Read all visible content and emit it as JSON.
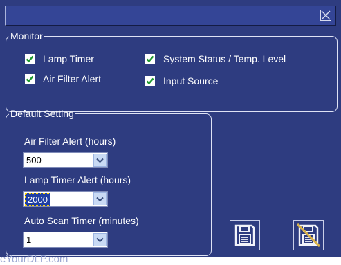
{
  "monitor": {
    "title": "Monitor",
    "options": [
      {
        "label": "Lamp Timer",
        "checked": true
      },
      {
        "label": "System Status / Temp. Level",
        "checked": true
      },
      {
        "label": "Air Filter Alert",
        "checked": true
      },
      {
        "label": "Input Source",
        "checked": true
      }
    ]
  },
  "default_setting": {
    "title": "Default Setting",
    "air_filter_alert": {
      "label": "Air Filter Alert (hours)",
      "value": "500"
    },
    "lamp_timer_alert": {
      "label": "Lamp Timer Alert (hours)",
      "value": "2000"
    },
    "auto_scan_timer": {
      "label": "Auto Scan Timer (minutes)",
      "value": "1"
    }
  },
  "icons": {
    "close": "close-icon",
    "save": "floppy-disk-icon",
    "no_save": "floppy-disk-crossed-icon",
    "check": "checkmark-icon",
    "dropdown": "chevron-down-icon"
  },
  "colors": {
    "background": "#2e3c80",
    "check": "#1e9a2e",
    "cancel_slash": "#d7b14a",
    "highlight": "#1f3fa4"
  },
  "watermark": "eYourDLP.com"
}
